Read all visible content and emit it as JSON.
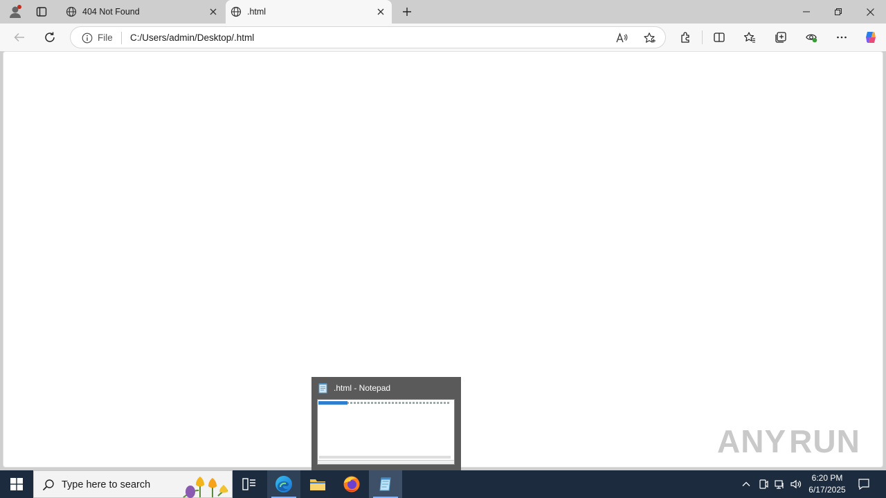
{
  "browser": {
    "tabs": [
      {
        "title": "404 Not Found",
        "active": false
      },
      {
        "title": ".html",
        "active": true
      }
    ],
    "address": {
      "scheme_label": "File",
      "url": "C:/Users/admin/Desktop/.html"
    }
  },
  "watermark": {
    "left": "ANY",
    "right": "RUN"
  },
  "notepad_preview": {
    "title": ".html - Notepad"
  },
  "taskbar": {
    "search_placeholder": "Type here to search",
    "clock": {
      "time": "6:20 PM",
      "date": "6/17/2025"
    }
  },
  "colors": {
    "taskbar": "#1c2b3d",
    "tab_strip": "#cecece",
    "accent": "#2f7fd1"
  }
}
